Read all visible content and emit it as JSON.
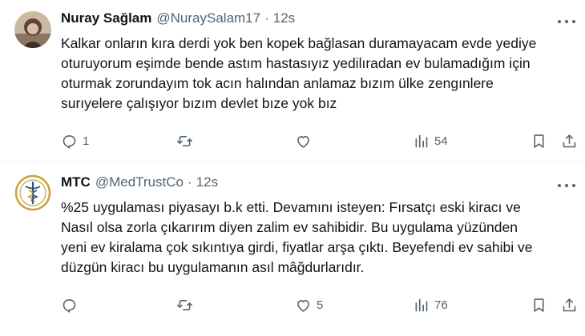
{
  "tweets": [
    {
      "author_name": "Nuray Sağlam",
      "handle": "@NuraySalam17",
      "separator": "·",
      "time": "12s",
      "text": "Kalkar onların kıra derdi yok ben kopek bağlasan duramayacam evde yediye\noturuyorum eşimde bende astım hastasıyız yedilıradan ev bulamadığım için\noturmak zorundayım tok acın halından anlamaz bızım ülke zengınlere\nsurıyelere çalışıyor bızım devlet bıze yok bız",
      "replies": "1",
      "retweets": "",
      "likes": "",
      "views": "54"
    },
    {
      "author_name": "MTC",
      "handle": "@MedTrustCo",
      "separator": "·",
      "time": "12s",
      "text": "%25 uygulaması piyasayı b.k etti. Devamını isteyen: Fırsatçı eski kiracı ve\nNasıl olsa zorla çıkarırım diyen zalim ev sahibidir. Bu uygulama yüzünden\nyeni ev kiralama çok sıkıntıya girdi, fiyatlar arşa çıktı. Beyefendi ev sahibi ve\ndüzgün kiracı bu uygulamanın asıl mâğdurlarıdır.",
      "replies": "",
      "retweets": "",
      "likes": "5",
      "views": "76"
    }
  ],
  "colors": {
    "text": "#0f1419",
    "muted": "#536471",
    "divider": "#eff3f4",
    "logo_gold": "#c9a23a",
    "logo_blue": "#2b4f7a"
  },
  "icons": [
    "more-icon",
    "reply-icon",
    "retweet-icon",
    "like-icon",
    "views-icon",
    "bookmark-icon",
    "share-icon"
  ]
}
